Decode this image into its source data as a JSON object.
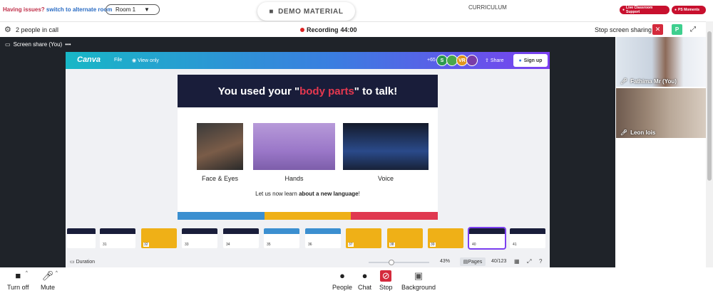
{
  "topbar": {
    "issues_text": "Having issues?",
    "alt_room_link": "switch to alternate room",
    "room_select": "Room 1",
    "demo_material": "DEMO MATERIAL",
    "curriculum": "CURRICULUM",
    "live_support": "Live Classroom Support",
    "ps_moments": "PS Moments"
  },
  "callbar": {
    "people_in_call": "2 people in call",
    "recording_label": "Recording",
    "recording_time": "44:00",
    "stop_sharing": "Stop screen sharing",
    "close_x": "✕",
    "profile_initial": "P"
  },
  "share": {
    "label": "Screen share (You)",
    "more": "•••"
  },
  "canva": {
    "logo": "Canva",
    "file": "File",
    "view_only": "View only",
    "plus_count": "+65",
    "avatars": [
      {
        "letter": "S",
        "color": "#2e9a4f"
      },
      {
        "letter": "",
        "color": "#4aa84a"
      },
      {
        "letter": "VR",
        "color": "#e0951f"
      },
      {
        "letter": "",
        "color": "#7a3ca8"
      }
    ],
    "share": "Share",
    "sign_up": "Sign up",
    "duration": "Duration",
    "zoom": "43%",
    "pages": "Pages",
    "page_count": "40/123"
  },
  "slide": {
    "title_before": "You used your \"",
    "title_highlight": "body parts",
    "title_after": "\" to talk!",
    "captions": [
      "Face & Eyes",
      "Hands",
      "Voice"
    ],
    "learn_before": "Let us now learn ",
    "learn_bold": "about a new language",
    "learn_after": "!",
    "stripe_colors": [
      "#3b8fd0",
      "#efb017",
      "#e0384f"
    ]
  },
  "thumbnails": [
    {
      "num": "",
      "color": "#191d3a"
    },
    {
      "num": "31",
      "color": "#191d3a"
    },
    {
      "num": "32",
      "color": "#efb017"
    },
    {
      "num": "33",
      "color": "#191d3a"
    },
    {
      "num": "34",
      "color": "#191d3a"
    },
    {
      "num": "35",
      "color": "#3b8fd0"
    },
    {
      "num": "36",
      "color": "#3b8fd0"
    },
    {
      "num": "37",
      "color": "#efb017"
    },
    {
      "num": "38",
      "color": "#efb017"
    },
    {
      "num": "39",
      "color": "#efb017"
    },
    {
      "num": "40",
      "color": "#191d3a"
    },
    {
      "num": "41",
      "color": "#191d3a"
    }
  ],
  "participants": [
    {
      "name": "Fathima Mr (You)"
    },
    {
      "name": "Leon lois"
    }
  ],
  "toolbar": {
    "turn_off": "Turn off",
    "mute": "Mute",
    "people": "People",
    "chat": "Chat",
    "stop": "Stop",
    "background": "Background"
  }
}
